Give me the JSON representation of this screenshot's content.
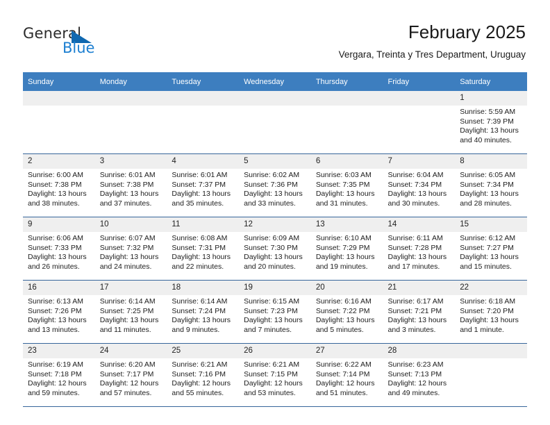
{
  "brand": {
    "name_top": "General",
    "name_bottom": "Blue",
    "accent_color": "#1c7fd1",
    "triangle_color": "#1068b0"
  },
  "header": {
    "title": "February 2025",
    "subtitle": "Vergara, Treinta y Tres Department, Uruguay"
  },
  "theme": {
    "header_row_bg": "#3d7ebf",
    "header_row_text": "#ffffff",
    "daynum_bg": "#efefef",
    "row_divider": "#36659a"
  },
  "weekdays": [
    "Sunday",
    "Monday",
    "Tuesday",
    "Wednesday",
    "Thursday",
    "Friday",
    "Saturday"
  ],
  "weeks": [
    [
      {
        "day": "",
        "sunrise": "",
        "sunset": "",
        "daylight_1": "",
        "daylight_2": ""
      },
      {
        "day": "",
        "sunrise": "",
        "sunset": "",
        "daylight_1": "",
        "daylight_2": ""
      },
      {
        "day": "",
        "sunrise": "",
        "sunset": "",
        "daylight_1": "",
        "daylight_2": ""
      },
      {
        "day": "",
        "sunrise": "",
        "sunset": "",
        "daylight_1": "",
        "daylight_2": ""
      },
      {
        "day": "",
        "sunrise": "",
        "sunset": "",
        "daylight_1": "",
        "daylight_2": ""
      },
      {
        "day": "",
        "sunrise": "",
        "sunset": "",
        "daylight_1": "",
        "daylight_2": ""
      },
      {
        "day": "1",
        "sunrise": "Sunrise: 5:59 AM",
        "sunset": "Sunset: 7:39 PM",
        "daylight_1": "Daylight: 13 hours",
        "daylight_2": "and 40 minutes."
      }
    ],
    [
      {
        "day": "2",
        "sunrise": "Sunrise: 6:00 AM",
        "sunset": "Sunset: 7:38 PM",
        "daylight_1": "Daylight: 13 hours",
        "daylight_2": "and 38 minutes."
      },
      {
        "day": "3",
        "sunrise": "Sunrise: 6:01 AM",
        "sunset": "Sunset: 7:38 PM",
        "daylight_1": "Daylight: 13 hours",
        "daylight_2": "and 37 minutes."
      },
      {
        "day": "4",
        "sunrise": "Sunrise: 6:01 AM",
        "sunset": "Sunset: 7:37 PM",
        "daylight_1": "Daylight: 13 hours",
        "daylight_2": "and 35 minutes."
      },
      {
        "day": "5",
        "sunrise": "Sunrise: 6:02 AM",
        "sunset": "Sunset: 7:36 PM",
        "daylight_1": "Daylight: 13 hours",
        "daylight_2": "and 33 minutes."
      },
      {
        "day": "6",
        "sunrise": "Sunrise: 6:03 AM",
        "sunset": "Sunset: 7:35 PM",
        "daylight_1": "Daylight: 13 hours",
        "daylight_2": "and 31 minutes."
      },
      {
        "day": "7",
        "sunrise": "Sunrise: 6:04 AM",
        "sunset": "Sunset: 7:34 PM",
        "daylight_1": "Daylight: 13 hours",
        "daylight_2": "and 30 minutes."
      },
      {
        "day": "8",
        "sunrise": "Sunrise: 6:05 AM",
        "sunset": "Sunset: 7:34 PM",
        "daylight_1": "Daylight: 13 hours",
        "daylight_2": "and 28 minutes."
      }
    ],
    [
      {
        "day": "9",
        "sunrise": "Sunrise: 6:06 AM",
        "sunset": "Sunset: 7:33 PM",
        "daylight_1": "Daylight: 13 hours",
        "daylight_2": "and 26 minutes."
      },
      {
        "day": "10",
        "sunrise": "Sunrise: 6:07 AM",
        "sunset": "Sunset: 7:32 PM",
        "daylight_1": "Daylight: 13 hours",
        "daylight_2": "and 24 minutes."
      },
      {
        "day": "11",
        "sunrise": "Sunrise: 6:08 AM",
        "sunset": "Sunset: 7:31 PM",
        "daylight_1": "Daylight: 13 hours",
        "daylight_2": "and 22 minutes."
      },
      {
        "day": "12",
        "sunrise": "Sunrise: 6:09 AM",
        "sunset": "Sunset: 7:30 PM",
        "daylight_1": "Daylight: 13 hours",
        "daylight_2": "and 20 minutes."
      },
      {
        "day": "13",
        "sunrise": "Sunrise: 6:10 AM",
        "sunset": "Sunset: 7:29 PM",
        "daylight_1": "Daylight: 13 hours",
        "daylight_2": "and 19 minutes."
      },
      {
        "day": "14",
        "sunrise": "Sunrise: 6:11 AM",
        "sunset": "Sunset: 7:28 PM",
        "daylight_1": "Daylight: 13 hours",
        "daylight_2": "and 17 minutes."
      },
      {
        "day": "15",
        "sunrise": "Sunrise: 6:12 AM",
        "sunset": "Sunset: 7:27 PM",
        "daylight_1": "Daylight: 13 hours",
        "daylight_2": "and 15 minutes."
      }
    ],
    [
      {
        "day": "16",
        "sunrise": "Sunrise: 6:13 AM",
        "sunset": "Sunset: 7:26 PM",
        "daylight_1": "Daylight: 13 hours",
        "daylight_2": "and 13 minutes."
      },
      {
        "day": "17",
        "sunrise": "Sunrise: 6:14 AM",
        "sunset": "Sunset: 7:25 PM",
        "daylight_1": "Daylight: 13 hours",
        "daylight_2": "and 11 minutes."
      },
      {
        "day": "18",
        "sunrise": "Sunrise: 6:14 AM",
        "sunset": "Sunset: 7:24 PM",
        "daylight_1": "Daylight: 13 hours",
        "daylight_2": "and 9 minutes."
      },
      {
        "day": "19",
        "sunrise": "Sunrise: 6:15 AM",
        "sunset": "Sunset: 7:23 PM",
        "daylight_1": "Daylight: 13 hours",
        "daylight_2": "and 7 minutes."
      },
      {
        "day": "20",
        "sunrise": "Sunrise: 6:16 AM",
        "sunset": "Sunset: 7:22 PM",
        "daylight_1": "Daylight: 13 hours",
        "daylight_2": "and 5 minutes."
      },
      {
        "day": "21",
        "sunrise": "Sunrise: 6:17 AM",
        "sunset": "Sunset: 7:21 PM",
        "daylight_1": "Daylight: 13 hours",
        "daylight_2": "and 3 minutes."
      },
      {
        "day": "22",
        "sunrise": "Sunrise: 6:18 AM",
        "sunset": "Sunset: 7:20 PM",
        "daylight_1": "Daylight: 13 hours",
        "daylight_2": "and 1 minute."
      }
    ],
    [
      {
        "day": "23",
        "sunrise": "Sunrise: 6:19 AM",
        "sunset": "Sunset: 7:18 PM",
        "daylight_1": "Daylight: 12 hours",
        "daylight_2": "and 59 minutes."
      },
      {
        "day": "24",
        "sunrise": "Sunrise: 6:20 AM",
        "sunset": "Sunset: 7:17 PM",
        "daylight_1": "Daylight: 12 hours",
        "daylight_2": "and 57 minutes."
      },
      {
        "day": "25",
        "sunrise": "Sunrise: 6:21 AM",
        "sunset": "Sunset: 7:16 PM",
        "daylight_1": "Daylight: 12 hours",
        "daylight_2": "and 55 minutes."
      },
      {
        "day": "26",
        "sunrise": "Sunrise: 6:21 AM",
        "sunset": "Sunset: 7:15 PM",
        "daylight_1": "Daylight: 12 hours",
        "daylight_2": "and 53 minutes."
      },
      {
        "day": "27",
        "sunrise": "Sunrise: 6:22 AM",
        "sunset": "Sunset: 7:14 PM",
        "daylight_1": "Daylight: 12 hours",
        "daylight_2": "and 51 minutes."
      },
      {
        "day": "28",
        "sunrise": "Sunrise: 6:23 AM",
        "sunset": "Sunset: 7:13 PM",
        "daylight_1": "Daylight: 12 hours",
        "daylight_2": "and 49 minutes."
      },
      {
        "day": "",
        "sunrise": "",
        "sunset": "",
        "daylight_1": "",
        "daylight_2": ""
      }
    ]
  ]
}
